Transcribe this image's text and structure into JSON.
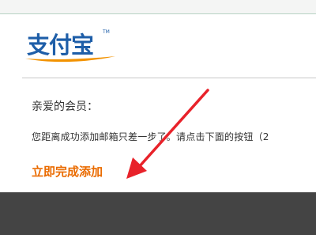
{
  "header": {
    "logo_text": "支付宝",
    "logo_tm": "TM"
  },
  "email": {
    "greeting": "亲爱的会员：",
    "message": "您距离成功添加邮箱只差一步了。请点击下面的按钮（2",
    "action_label": "立即完成添加"
  },
  "annotation": {
    "arrow_color": "#e8222a"
  },
  "colors": {
    "action": "#ea6b00",
    "logo_blue": "#1e5ea8",
    "logo_orange": "#f29200",
    "footer_bg": "#444444"
  }
}
